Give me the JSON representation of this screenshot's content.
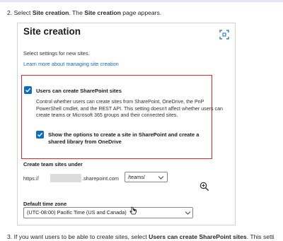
{
  "instructions": {
    "step2": {
      "num": "2.",
      "pre": "Select",
      "b1": "Site creation",
      "mid": ". The",
      "b2": "Site creation",
      "post": "page appears."
    },
    "step3": {
      "num": "3.",
      "pre": "If you want users to be able to create sites, select",
      "b1": "Users can create SharePoint sites",
      "post": ". This setti"
    }
  },
  "panel": {
    "title": "Site creation",
    "settings_description": "Select settings for new sites.",
    "learn_link": "Learn more about managing site creation",
    "users_can_create_label": "Users can create SharePoint sites",
    "control_description": "Control whether users can create sites from SharePoint, OneDrive, the PnP PowerShell cmdlet, and the REST API. This setting doesn't affect whether users can create teams or Microsoft 365 groups and their connected sites.",
    "show_options_label": "Show the options to create a site in SharePoint and create a shared library from OneDrive",
    "create_team_sites_label": "Create team sites under",
    "url_prefix": "https://",
    "url_domain": ".sharepoint.com",
    "teams_path_value": "/teams/",
    "default_time_zone_label": "Default time zone",
    "time_zone_value": "(UTC-08:00) Pacific Time (US and Canada)"
  },
  "colors": {
    "accent": "#0f6cbd",
    "highlight": "#e3262b"
  },
  "icons": [
    "expand-icon",
    "checkmark-icon",
    "chevron-down-icon",
    "zoom-in-icon",
    "cursor-icon"
  ]
}
